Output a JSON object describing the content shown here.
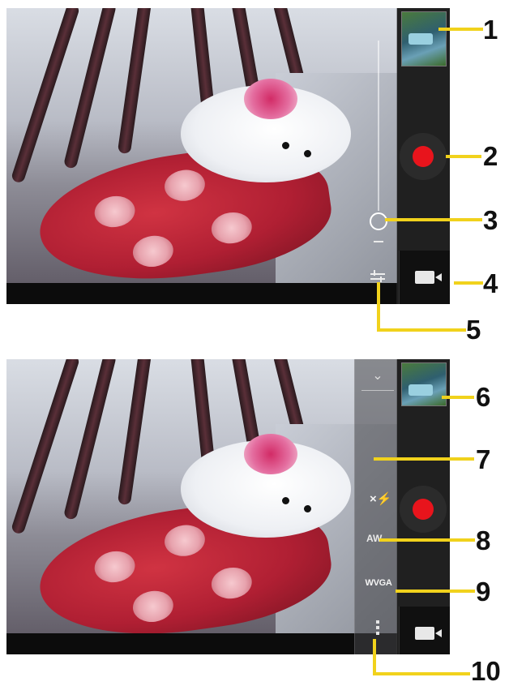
{
  "screen_top": {
    "controls": {
      "thumbnail": "gallery-thumbnail",
      "record_button": "record",
      "zoom_slider": "zoom",
      "mode_switch": "video-mode",
      "settings_toggle": "settings"
    }
  },
  "screen_bottom": {
    "menu": {
      "collapse_icon": "chevron-down-icon",
      "flash_label": "×",
      "white_balance_label": "AW",
      "resolution_label": "WVGA"
    }
  },
  "callouts": {
    "n1": "1",
    "n2": "2",
    "n3": "3",
    "n4": "4",
    "n5": "5",
    "n6": "6",
    "n7": "7",
    "n8": "8",
    "n9": "9",
    "n10": "10"
  },
  "colors": {
    "record_red": "#e8141c",
    "callout_yellow": "#f1d21c"
  }
}
